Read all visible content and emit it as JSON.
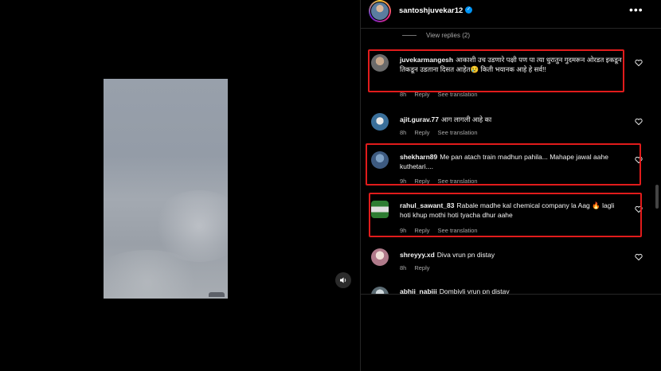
{
  "header": {
    "username": "santoshjuvekar12",
    "verified_icon": "verified-badge-icon",
    "more_icon": "more-icon",
    "more_glyph": "•••"
  },
  "view_replies": "View replies (2)",
  "comments": [
    {
      "user": "juvekarmangesh",
      "text": "आकाशी उच उडणारे पक्षी पण पा त्या धुरातुन गुदमरून ओरडत इकडून तिकडून उडताना दिसत आहेत😢 किती भयानक आहे हे सर्व!!",
      "time": "8h",
      "reply": "Reply",
      "translate": "See translation"
    },
    {
      "user": "ajit.gurav.77",
      "text": "आग लागली आहे का",
      "time": "8h",
      "reply": "Reply",
      "translate": "See translation"
    },
    {
      "user": "shekharn89",
      "text": "Me pan atach train madhun pahila... Mahape jawal aahe kuthetari....",
      "time": "9h",
      "reply": "Reply",
      "translate": "See translation"
    },
    {
      "user": "rahul_sawant_83",
      "text": "Rabale madhe kal chemical company la Aag 🔥 lagli hoti khup mothi hoti tyacha dhur aahe",
      "time": "9h",
      "reply": "Reply",
      "translate": "See translation"
    },
    {
      "user": "shreyyy.xd",
      "text": "Diva vrun pn distay",
      "time": "8h",
      "reply": "Reply",
      "translate": ""
    },
    {
      "user": "abhii_nabiii",
      "text": "Dombivli vrun pn distay",
      "time": "",
      "reply": "",
      "translate": ""
    }
  ],
  "colors": {
    "highlight": "#e11b1b",
    "verified": "#0095f6",
    "muted_text": "#a8a8a8"
  },
  "media": {
    "mute_icon": "speaker-icon"
  }
}
